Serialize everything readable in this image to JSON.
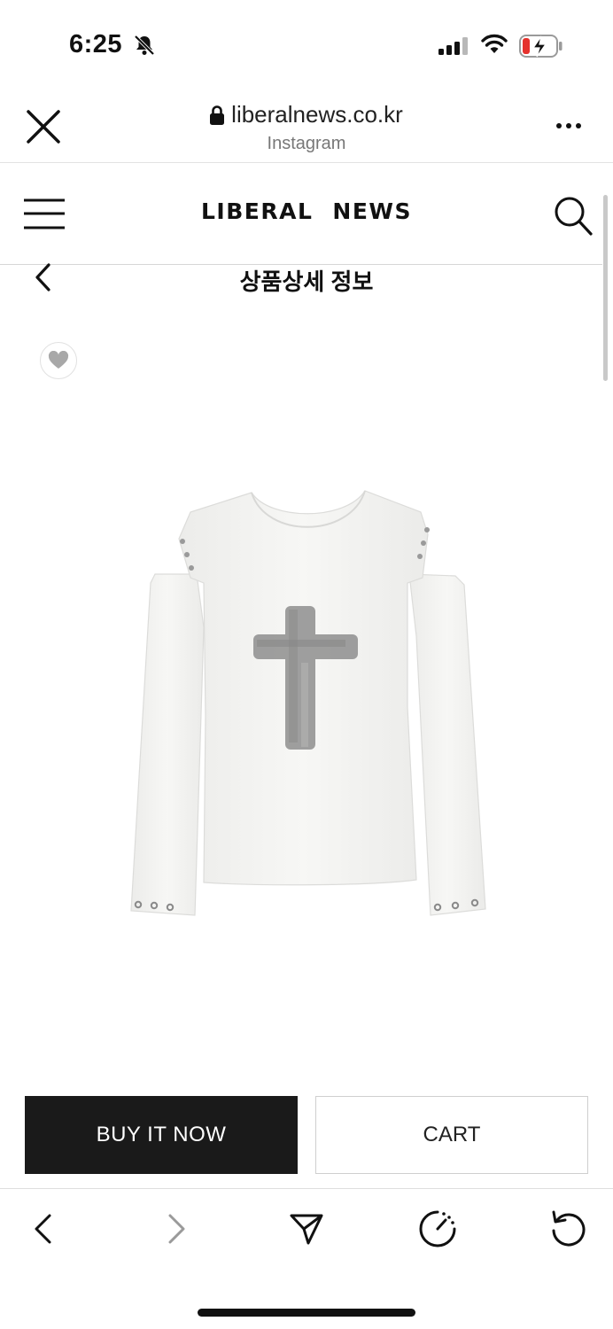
{
  "status_bar": {
    "time": "6:25",
    "icons": [
      "bell-slash-icon",
      "signal-icon",
      "wifi-icon",
      "battery-charging-icon"
    ],
    "battery_color": "#e5322d"
  },
  "browser": {
    "url": "liberalnews.co.kr",
    "source": "Instagram",
    "icons": [
      "close-icon",
      "lock-icon",
      "more-icon"
    ]
  },
  "site_header": {
    "logo_word1": "LIBERAL",
    "logo_word2": "NEWS",
    "icons": [
      "hamburger-menu-icon",
      "search-icon"
    ]
  },
  "page": {
    "title": "상품상세 정보",
    "icons": [
      "back-icon",
      "heart-icon"
    ],
    "product_image": "white cut-out sleeve long-sleeve top with grey brushed cross print"
  },
  "actions": {
    "buy_label": "BUY IT NOW",
    "cart_label": "CART",
    "buy_color": "#1a1a1a"
  },
  "bottom_nav": {
    "icons": [
      "back-arrow-icon",
      "forward-arrow-icon",
      "share-icon",
      "speed-icon",
      "reload-icon"
    ]
  }
}
